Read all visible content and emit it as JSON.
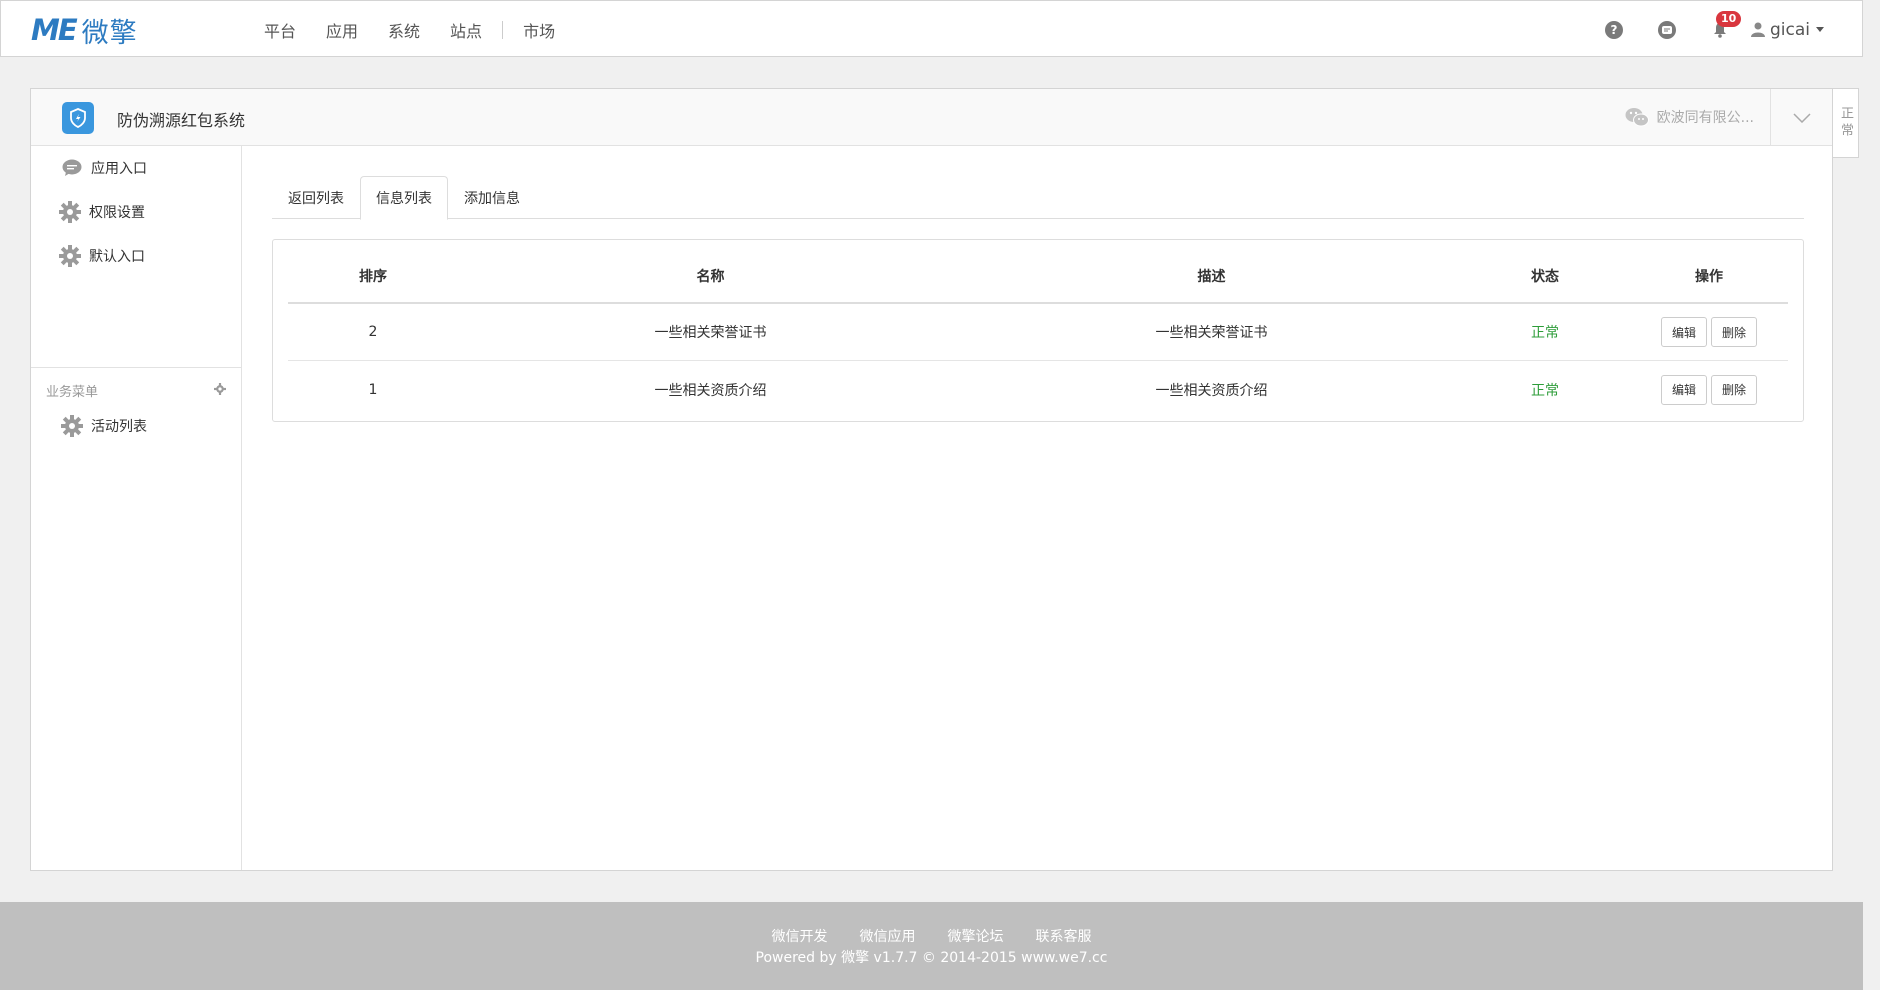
{
  "logo": {
    "mark": "MЕ",
    "text": "微擎"
  },
  "nav": {
    "items": [
      "平台",
      "应用",
      "系统",
      "站点",
      "市场"
    ]
  },
  "header_right": {
    "help_icon": "question-icon",
    "message_icon": "chat-icon",
    "bell_icon": "bell-icon",
    "notification_count": "10",
    "username": "gicai"
  },
  "panel": {
    "app_title": "防伪溯源红包系统",
    "account_name": "欧波同有限公...",
    "side_tab": "正常"
  },
  "sidebar": {
    "items": [
      {
        "label": "应用入口",
        "icon": "chat-bubble-icon"
      },
      {
        "label": "权限设置",
        "icon": "gear-icon"
      },
      {
        "label": "默认入口",
        "icon": "gear-icon"
      }
    ],
    "group_title": "业务菜单",
    "group_items": [
      {
        "label": "活动列表",
        "icon": "gear-icon"
      }
    ]
  },
  "tabs": [
    "返回列表",
    "信息列表",
    "添加信息"
  ],
  "table": {
    "headers": [
      "排序",
      "名称",
      "描述",
      "状态",
      "操作"
    ],
    "rows": [
      {
        "order": "2",
        "name": "一些相关荣誉证书",
        "desc": "一些相关荣誉证书",
        "status": "正常",
        "edit": "编辑",
        "delete": "删除"
      },
      {
        "order": "1",
        "name": "一些相关资质介绍",
        "desc": "一些相关资质介绍",
        "status": "正常",
        "edit": "编辑",
        "delete": "删除"
      }
    ]
  },
  "footer": {
    "links": [
      "微信开发",
      "微信应用",
      "微擎论坛",
      "联系客服"
    ],
    "copyright": "Powered by 微擎 v1.7.7 © 2014-2015 www.we7.cc"
  },
  "colors": {
    "brand": "#2d7bc1",
    "status_ok": "#2e9d3a",
    "badge": "#d9363e",
    "footer_bg": "#bfbfbf"
  }
}
